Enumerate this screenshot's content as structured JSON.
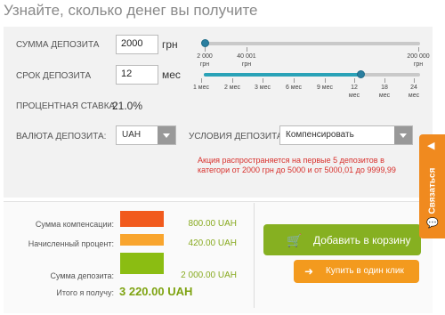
{
  "title": "Узнайте, сколько денег вы получите",
  "amount": {
    "label": "Сумма депозита",
    "value": "2000",
    "unit": "грн",
    "slider_fraction": 0.0
  },
  "amount_ticks": [
    {
      "top": "2 000",
      "bottom": "грн"
    },
    {
      "top": "40 001",
      "bottom": "грн"
    },
    {
      "top": "200 000",
      "bottom": "грн"
    }
  ],
  "term": {
    "label": "Срок депозита",
    "value": "12",
    "unit": "мес",
    "slider_fraction": 0.75
  },
  "term_ticks": [
    {
      "top": "1 мес",
      "bottom": ""
    },
    {
      "top": "2 мес",
      "bottom": ""
    },
    {
      "top": "3 мес",
      "bottom": ""
    },
    {
      "top": "6 мес",
      "bottom": ""
    },
    {
      "top": "9 мес",
      "bottom": ""
    },
    {
      "top": "12",
      "bottom": "мес"
    },
    {
      "top": "18",
      "bottom": "мес"
    },
    {
      "top": "24",
      "bottom": "мес"
    }
  ],
  "rate": {
    "label": "Процентная ставка:",
    "value": "21.0%"
  },
  "currency": {
    "label": "Валюта депозита:",
    "selected": "UAH"
  },
  "conditions": {
    "label": "Условия депозита:",
    "selected": "Компенсировать"
  },
  "promo": "Акция распространяется на первые 5 депозитов в категори от 2000 грн до 5000 и от 5000,01 до 9999,99",
  "results": {
    "compensation": {
      "label": "Сумма компенсации:",
      "amount": "800.00 UAH",
      "color": "#f15a1d"
    },
    "interest": {
      "label": "Начисленный процент:",
      "amount": "420.00 UAH",
      "color": "#f9a52e"
    },
    "deposit": {
      "label": "Сумма депозита:",
      "amount": "2 000.00 UAH",
      "color": "#8bbd12"
    },
    "total": {
      "label": "Итого я получу:",
      "amount": "3 220.00 UAH"
    }
  },
  "buttons": {
    "cart": "Добавить в корзину",
    "buy": "Купить в один клик"
  },
  "side_tab": {
    "label": "Связаться"
  }
}
